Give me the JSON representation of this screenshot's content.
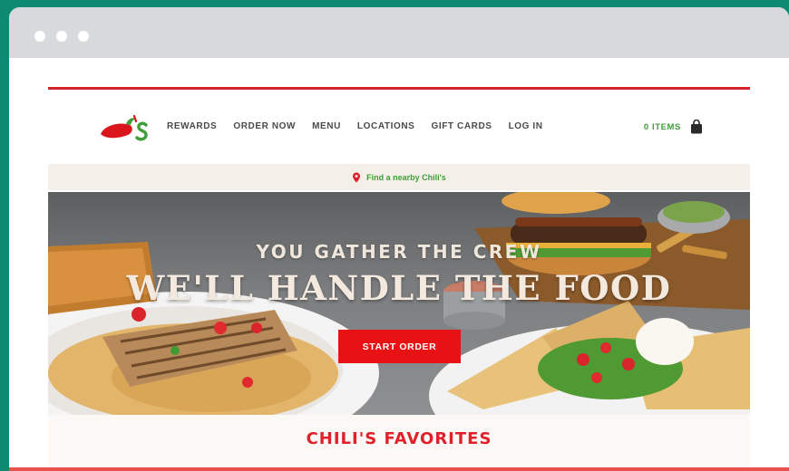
{
  "nav": {
    "items": [
      {
        "label": "REWARDS",
        "name": "nav-rewards"
      },
      {
        "label": "ORDER NOW",
        "name": "nav-order-now"
      },
      {
        "label": "MENU",
        "name": "nav-menu"
      },
      {
        "label": "LOCATIONS",
        "name": "nav-locations"
      },
      {
        "label": "GIFT CARDS",
        "name": "nav-gift-cards"
      },
      {
        "label": "LOG IN",
        "name": "nav-log-in"
      }
    ],
    "cart_label": "0 ITEMS"
  },
  "promo": {
    "text": "Find a nearby Chili's",
    "icon": "location-pin-icon"
  },
  "hero": {
    "kicker": "YOU GATHER THE CREW",
    "headline": "WE'LL HANDLE THE FOOD",
    "cta_label": "START ORDER"
  },
  "favorites": {
    "title": "CHILI'S FAVORITES"
  },
  "colors": {
    "brand_red": "#e81215",
    "accent_green": "#3e9e3a",
    "frame_teal": "#0f8a72"
  }
}
